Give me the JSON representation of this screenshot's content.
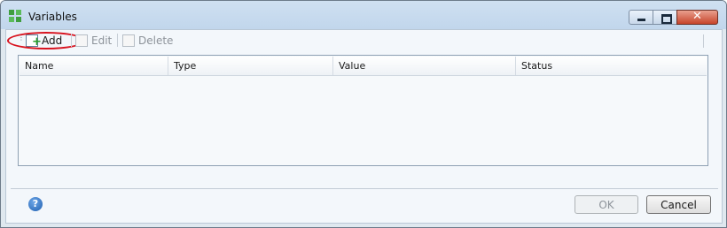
{
  "window": {
    "title": "Variables"
  },
  "titlebar_buttons": {
    "minimize": "minimize",
    "maximize": "maximize",
    "close": "✕"
  },
  "toolbar": {
    "add_label": "Add",
    "edit_label": "Edit",
    "delete_label": "Delete"
  },
  "grid": {
    "columns": [
      "Name",
      "Type",
      "Value",
      "Status"
    ],
    "rows": []
  },
  "footer": {
    "help_glyph": "?",
    "ok_label": "OK",
    "cancel_label": "Cancel"
  },
  "colors": {
    "highlight_circle": "#d8131f",
    "titlebar": "#c8dbef"
  }
}
